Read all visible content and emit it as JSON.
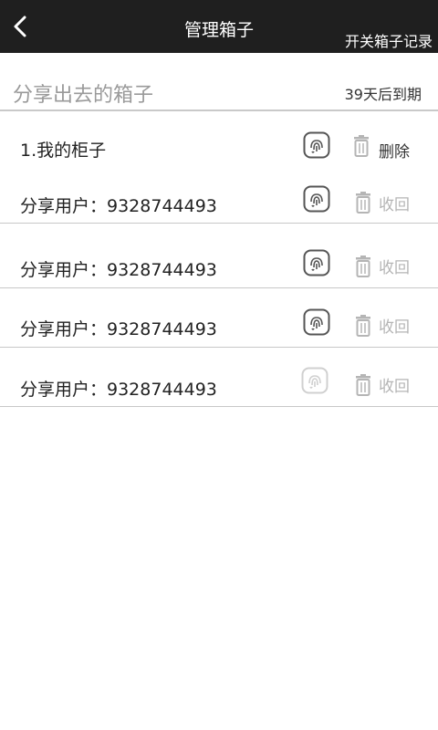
{
  "header": {
    "title": "管理箱子",
    "records_link": "开关箱子记录"
  },
  "section": {
    "title": "分享出去的箱子",
    "expiry": "39天后到期"
  },
  "box": {
    "name": "1.我的柜子",
    "delete_label": "删除"
  },
  "shares": [
    {
      "label": "分享用户：9328744493",
      "action": "收回"
    },
    {
      "label": "分享用户：9328744493",
      "action": "收回"
    },
    {
      "label": "分享用户：9328744493",
      "action": "收回"
    },
    {
      "label": "分享用户：9328744493",
      "action": "收回"
    }
  ],
  "colors": {
    "topbar": "#1f1f1f",
    "divider": "#c8c8c8",
    "muted_text": "#b5b5b5"
  }
}
